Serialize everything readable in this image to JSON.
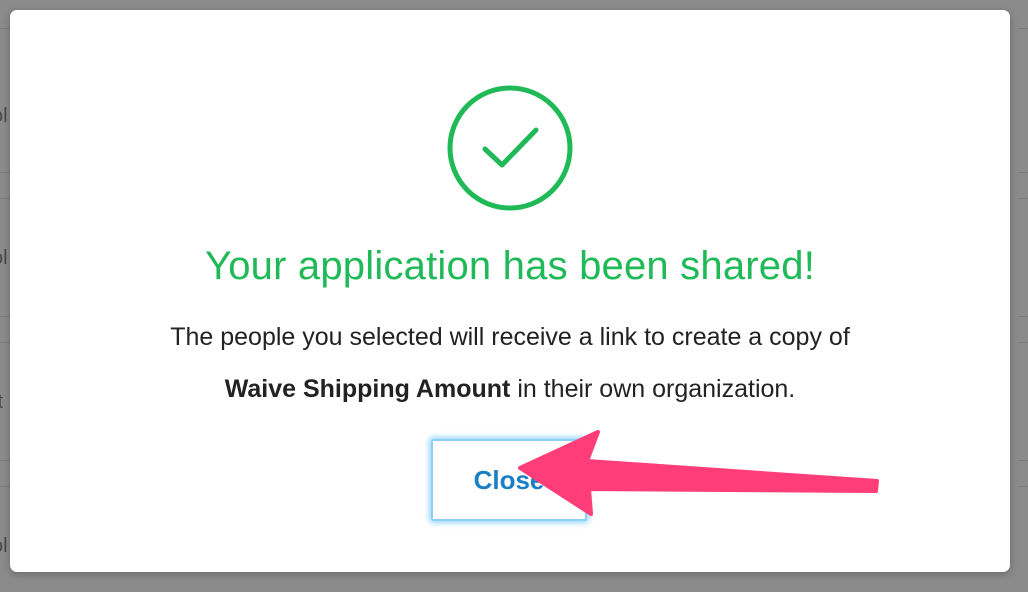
{
  "background": {
    "fragments": [
      "ol",
      "ol",
      "ft",
      "ol"
    ]
  },
  "modal": {
    "icon": "check-circle-icon",
    "title": "Your application has been shared!",
    "message_before": "The people you selected will receive a link to create a copy of",
    "app_name": "Waive Shipping Amount",
    "message_after": "in their own organization.",
    "close_label": "Close"
  },
  "colors": {
    "success": "#1fba57",
    "button_text": "#1a7fc4",
    "button_glow": "#8fd1f5",
    "annotation_arrow": "#ff3d79"
  },
  "annotation": {
    "icon": "pointer-arrow-icon"
  }
}
